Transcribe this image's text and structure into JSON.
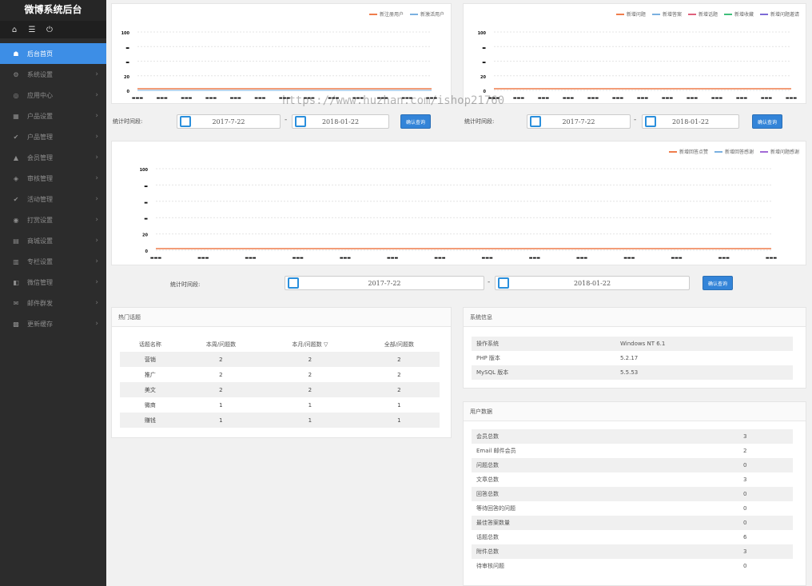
{
  "brand": "微博系统后台",
  "quickbar": {
    "home": "home-icon",
    "list": "list-icon",
    "power": "power-icon"
  },
  "menu": [
    {
      "label": "后台首页",
      "icon": "☗",
      "active": true
    },
    {
      "label": "系统设置",
      "icon": "⚙"
    },
    {
      "label": "应用中心",
      "icon": "◎"
    },
    {
      "label": "户品设置",
      "icon": "▦"
    },
    {
      "label": "户品管理",
      "icon": "✔"
    },
    {
      "label": "会员管理",
      "icon": "▲"
    },
    {
      "label": "审核管理",
      "icon": "◈"
    },
    {
      "label": "活动管理",
      "icon": "✔"
    },
    {
      "label": "打赏设置",
      "icon": "◉"
    },
    {
      "label": "商城设置",
      "icon": "▤"
    },
    {
      "label": "专栏设置",
      "icon": "▥"
    },
    {
      "label": "微信管理",
      "icon": "◧"
    },
    {
      "label": "邮件群发",
      "icon": "✉"
    },
    {
      "label": "更新缓存",
      "icon": "▩"
    }
  ],
  "chart1": {
    "legend": [
      {
        "label": "新注册用户",
        "color": "#ef7d4c"
      },
      {
        "label": "新激活用户",
        "color": "#7ab0e0"
      }
    ]
  },
  "chart2": {
    "legend": [
      {
        "label": "新增问题",
        "color": "#ef7d4c"
      },
      {
        "label": "新增答案",
        "color": "#7ab0e0"
      },
      {
        "label": "新增话题",
        "color": "#e0617c"
      },
      {
        "label": "新增收藏",
        "color": "#3fbf7a"
      },
      {
        "label": "新增问题邀请",
        "color": "#7c6ad6"
      }
    ]
  },
  "chart3": {
    "legend": [
      {
        "label": "新增回答点赞",
        "color": "#ef7d4c"
      },
      {
        "label": "新增回答感谢",
        "color": "#7ab0e0"
      },
      {
        "label": "新增问题感谢",
        "color": "#a26ad6"
      }
    ]
  },
  "chart_data": [
    {
      "type": "line",
      "series": [
        {
          "name": "新注册用户",
          "values": [
            0,
            0,
            0,
            0,
            0,
            0,
            0,
            0,
            0,
            0,
            0,
            0,
            0
          ]
        },
        {
          "name": "新激活用户",
          "values": [
            0,
            0,
            0,
            0,
            0,
            0,
            0,
            0,
            0,
            0,
            0,
            0,
            0
          ]
        }
      ],
      "yticks": [
        "100",
        "",
        "",
        "20",
        "0"
      ]
    },
    {
      "type": "line",
      "series": [
        {
          "name": "新增问题",
          "values": [
            0,
            0,
            0,
            0,
            0,
            0,
            0,
            0,
            0,
            0,
            0,
            0,
            0
          ]
        }
      ],
      "yticks": [
        "100",
        "",
        "",
        "20",
        "0"
      ]
    },
    {
      "type": "line",
      "series": [
        {
          "name": "新增回答点赞",
          "values": [
            0,
            0,
            0,
            0,
            0,
            0,
            0,
            0,
            0,
            0,
            0,
            0,
            0,
            0
          ]
        }
      ],
      "yticks": [
        "100",
        "",
        "",
        "",
        "20",
        "0"
      ]
    }
  ],
  "filters": {
    "label": "统计时间段:",
    "start": "2017-7-22",
    "end": "2018-01-22",
    "button": "确认查询",
    "dash": "-"
  },
  "hot_topics": {
    "title": "热门话题",
    "headers": [
      "话题名称",
      "本周/问题数",
      "本月/问题数 ▽",
      "全部/问题数"
    ],
    "rows": [
      [
        "营销",
        "2",
        "2",
        "2"
      ],
      [
        "推广",
        "2",
        "2",
        "2"
      ],
      [
        "美文",
        "2",
        "2",
        "2"
      ],
      [
        "微商",
        "1",
        "1",
        "1"
      ],
      [
        "赚钱",
        "1",
        "1",
        "1"
      ]
    ]
  },
  "system_info": {
    "title": "系统信息",
    "rows": [
      [
        "操作系统",
        "Windows NT 6.1"
      ],
      [
        "PHP 版本",
        "5.2.17"
      ],
      [
        "MySQL 版本",
        "5.5.53"
      ]
    ]
  },
  "user_data": {
    "title": "用户数据",
    "rows": [
      [
        "会员总数",
        "3"
      ],
      [
        "Email 邮件会员",
        "2"
      ],
      [
        "问题总数",
        "0"
      ],
      [
        "文章总数",
        "3"
      ],
      [
        "回答总数",
        "0"
      ],
      [
        "等待回答的问题",
        "0"
      ],
      [
        "最佳答案数量",
        "0"
      ],
      [
        "话题总数",
        "6"
      ],
      [
        "附件总数",
        "3"
      ],
      [
        "待审核问题",
        "0"
      ]
    ]
  },
  "watermark": "https://www.huzhan.com/ishop21760"
}
